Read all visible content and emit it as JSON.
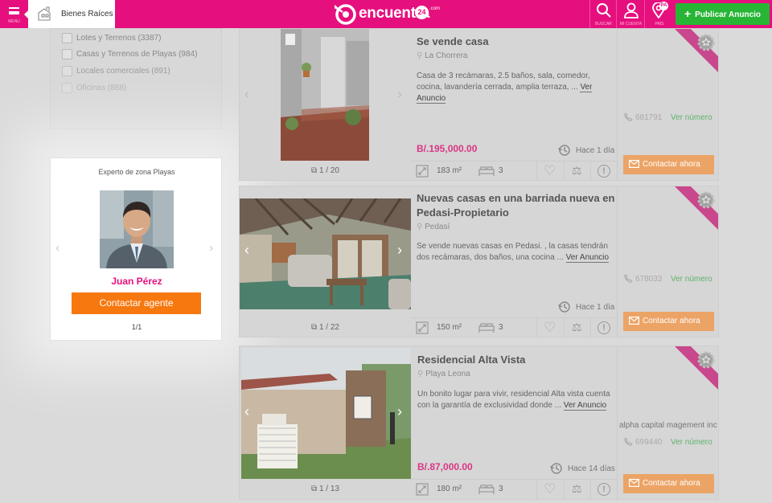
{
  "header": {
    "menu_label": "MENU",
    "category": "Bienes Raíces",
    "logo_text": "encuentra",
    "logo_number": "24",
    "logo_suffix": ".com",
    "search_label": "BUSCAR",
    "account_label": "MI CUENTA",
    "country_label": "PAÍS",
    "country_code": "PA",
    "publish_button": "Publicar Anuncio",
    "colors": {
      "brand": "#e60f7e",
      "publish": "#28b535",
      "accent": "#f7780f"
    }
  },
  "filters": [
    {
      "label": "Lotes y Terrenos (3387)"
    },
    {
      "label": "Casas y Terrenos de Playas (984)"
    },
    {
      "label": "Locales comerciales (891)"
    },
    {
      "label": "Oficinas (888)"
    }
  ],
  "agent": {
    "title": "Experto de zona Playas",
    "name": "Juan Pérez",
    "button": "Contactar agente",
    "page": "1/1"
  },
  "listings": [
    {
      "title_lines": [
        "Se vende casa"
      ],
      "location": "La Chorrera",
      "description": "Casa de 3 recámaras, 2.5 baños, sala, comedor, cocina, lavandería cerrada, amplia terraza, ... ",
      "more": "Ver Anuncio",
      "price": "B/.195,000.00",
      "ago": "Hace 1 día",
      "photo_counter": "1 / 20",
      "area": "183 m²",
      "beds": "3",
      "company": "",
      "phone": "681791",
      "phone_action": "Ver número",
      "contact": "Contactar ahora"
    },
    {
      "title_lines": [
        "Nuevas casas en una barriada nueva en",
        "Pedasi-Propietario"
      ],
      "location": "Pedasí",
      "description": "Se vende nuevas casas en Pedasi. , la casas tendrán dos recámaras, dos baños, una cocina ... ",
      "more": "Ver Anuncio",
      "price": "",
      "ago": "Hace 1 día",
      "photo_counter": "1 / 22",
      "area": "150 m²",
      "beds": "3",
      "company": "",
      "phone": "678033",
      "phone_action": "Ver número",
      "contact": "Contactar ahora"
    },
    {
      "title_lines": [
        "Residencial Alta Vista"
      ],
      "location": "Playa Leona",
      "description": "Un bonito lugar para vivir, residencial Alta vista cuenta con la garantía de exclusividad donde ... ",
      "more": "Ver Anuncio",
      "price": "B/.87,000.00",
      "ago": "Hace 14 días",
      "photo_counter": "1 / 13",
      "area": "180 m²",
      "beds": "3",
      "company": "alpha capital magement inc",
      "phone": "699440",
      "phone_action": "Ver número",
      "contact": "Contactar ahora"
    }
  ]
}
